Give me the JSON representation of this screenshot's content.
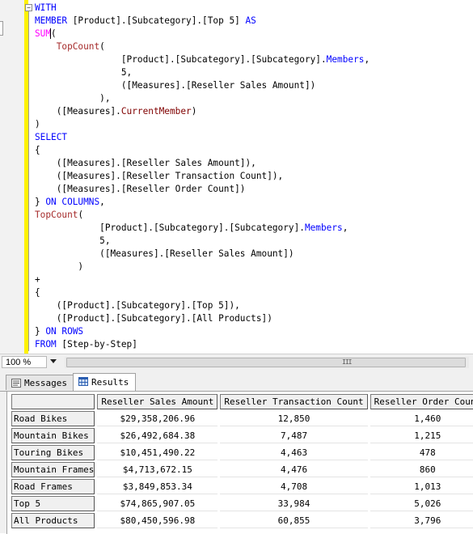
{
  "editor": {
    "fold_symbol": "−",
    "code_lines": [
      [
        {
          "t": "WITH",
          "c": "kw"
        }
      ],
      [
        {
          "t": "MEMBER",
          "c": "kw"
        },
        {
          "t": " [Product].[Subcategory].[Top 5] ",
          "c": ""
        },
        {
          "t": "AS",
          "c": "kw"
        }
      ],
      [
        {
          "t": "SUM",
          "c": "fn"
        },
        {
          "t": "(",
          "c": "cursor"
        }
      ],
      [
        {
          "t": "    ",
          "c": ""
        },
        {
          "t": "TopCount",
          "c": "fn2"
        },
        {
          "t": "(",
          "c": ""
        }
      ],
      [
        {
          "t": "                [Product].[Subcategory].[Subcategory].",
          "c": ""
        },
        {
          "t": "Members",
          "c": "kw"
        },
        {
          "t": ",",
          "c": ""
        }
      ],
      [
        {
          "t": "                5,",
          "c": ""
        }
      ],
      [
        {
          "t": "                ([Measures].[Reseller Sales Amount])",
          "c": ""
        }
      ],
      [
        {
          "t": "            ),",
          "c": ""
        }
      ],
      [
        {
          "t": "    ([Measures].",
          "c": ""
        },
        {
          "t": "CurrentMember",
          "c": "mb"
        },
        {
          "t": ")",
          "c": ""
        }
      ],
      [
        {
          "t": ")",
          "c": ""
        }
      ],
      [
        {
          "t": "SELECT",
          "c": "kw"
        }
      ],
      [
        {
          "t": "{",
          "c": ""
        }
      ],
      [
        {
          "t": "    ([Measures].[Reseller Sales Amount]),",
          "c": ""
        }
      ],
      [
        {
          "t": "    ([Measures].[Reseller Transaction Count]),",
          "c": ""
        }
      ],
      [
        {
          "t": "    ([Measures].[Reseller Order Count])",
          "c": ""
        }
      ],
      [
        {
          "t": "} ",
          "c": ""
        },
        {
          "t": "ON COLUMNS",
          "c": "kw"
        },
        {
          "t": ",",
          "c": ""
        }
      ],
      [
        {
          "t": "TopCount",
          "c": "fn2"
        },
        {
          "t": "(",
          "c": ""
        }
      ],
      [
        {
          "t": "            [Product].[Subcategory].[Subcategory].",
          "c": ""
        },
        {
          "t": "Members",
          "c": "kw"
        },
        {
          "t": ",",
          "c": ""
        }
      ],
      [
        {
          "t": "            5,",
          "c": ""
        }
      ],
      [
        {
          "t": "            ([Measures].[Reseller Sales Amount])",
          "c": ""
        }
      ],
      [
        {
          "t": "        )",
          "c": ""
        }
      ],
      [
        {
          "t": "+",
          "c": ""
        }
      ],
      [
        {
          "t": "{",
          "c": ""
        }
      ],
      [
        {
          "t": "    ([Product].[Subcategory].[Top 5]),",
          "c": ""
        }
      ],
      [
        {
          "t": "    ([Product].[Subcategory].[All Products])",
          "c": ""
        }
      ],
      [
        {
          "t": "} ",
          "c": ""
        },
        {
          "t": "ON ROWS",
          "c": "kw"
        }
      ],
      [
        {
          "t": "FROM",
          "c": "kw"
        },
        {
          "t": " [Step-by-Step]",
          "c": ""
        }
      ]
    ]
  },
  "status": {
    "zoom": "100 %",
    "scroll_grip": "III"
  },
  "tabs": [
    {
      "label": "Messages",
      "icon": "messages-icon",
      "active": false
    },
    {
      "label": "Results",
      "icon": "grid-icon",
      "active": true
    }
  ],
  "grid": {
    "columns": [
      "Reseller Sales Amount",
      "Reseller Transaction Count",
      "Reseller Order Count"
    ],
    "rows": [
      {
        "label": "Road Bikes",
        "values": [
          "$29,358,206.96",
          "12,850",
          "1,460"
        ]
      },
      {
        "label": "Mountain Bikes",
        "values": [
          "$26,492,684.38",
          "7,487",
          "1,215"
        ]
      },
      {
        "label": "Touring Bikes",
        "values": [
          "$10,451,490.22",
          "4,463",
          "478"
        ]
      },
      {
        "label": "Mountain Frames",
        "values": [
          "$4,713,672.15",
          "4,476",
          "860"
        ]
      },
      {
        "label": "Road Frames",
        "values": [
          "$3,849,853.34",
          "4,708",
          "1,013"
        ]
      },
      {
        "label": "Top 5",
        "values": [
          "$74,865,907.05",
          "33,984",
          "5,026"
        ]
      },
      {
        "label": "All Products",
        "values": [
          "$80,450,596.98",
          "60,855",
          "3,796"
        ]
      }
    ]
  }
}
